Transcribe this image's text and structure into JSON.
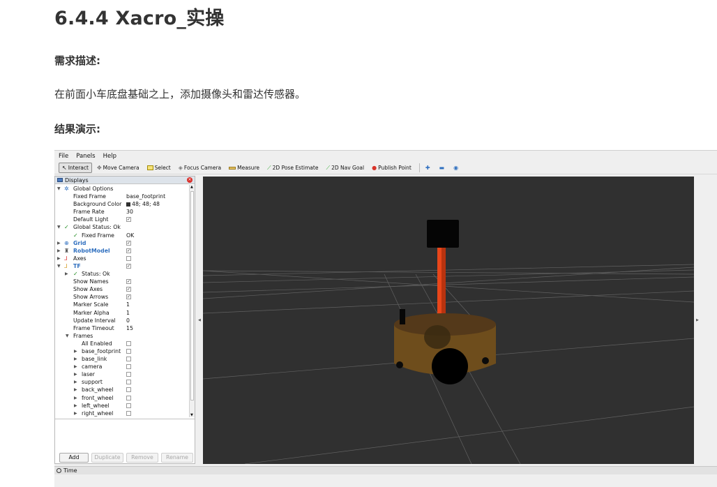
{
  "doc": {
    "title": "6.4.4 Xacro_实操",
    "h_requirement": "需求描述:",
    "p_requirement": "在前面小车底盘基础之上，添加摄像头和雷达传感器。",
    "h_result": "结果演示:"
  },
  "rviz": {
    "menu": {
      "file": "File",
      "panels": "Panels",
      "help": "Help"
    },
    "toolbar": {
      "interact": "Interact",
      "move_camera": "Move Camera",
      "select": "Select",
      "focus_camera": "Focus Camera",
      "measure": "Measure",
      "pose_estimate": "2D Pose Estimate",
      "nav_goal": "2D Nav Goal",
      "publish_point": "Publish Point"
    },
    "displays": {
      "title": "Displays",
      "rows": {
        "global_options": "Global Options",
        "fixed_frame": "Fixed Frame",
        "fixed_frame_val": "base_footprint",
        "bg_color": "Background Color",
        "bg_color_val": "48; 48; 48",
        "frame_rate": "Frame Rate",
        "frame_rate_val": "30",
        "default_light": "Default Light",
        "global_status": "Global Status: Ok",
        "fixed_frame_status": "Fixed Frame",
        "fixed_frame_status_val": "OK",
        "grid": "Grid",
        "robot_model": "RobotModel",
        "axes": "Axes",
        "tf": "TF",
        "tf_status": "Status: Ok",
        "show_names": "Show Names",
        "show_axes": "Show Axes",
        "show_arrows": "Show Arrows",
        "marker_scale": "Marker Scale",
        "marker_scale_val": "1",
        "marker_alpha": "Marker Alpha",
        "marker_alpha_val": "1",
        "update_interval": "Update Interval",
        "update_interval_val": "0",
        "frame_timeout": "Frame Timeout",
        "frame_timeout_val": "15",
        "frames": "Frames",
        "all_enabled": "All Enabled",
        "f_base_footprint": "base_footprint",
        "f_base_link": "base_link",
        "f_camera": "camera",
        "f_laser": "laser",
        "f_support": "support",
        "f_back_wheel": "back_wheel",
        "f_front_wheel": "front_wheel",
        "f_left_wheel": "left_wheel",
        "f_right_wheel": "right_wheel"
      },
      "buttons": {
        "add": "Add",
        "duplicate": "Duplicate",
        "remove": "Remove",
        "rename": "Rename"
      }
    },
    "time_panel": "Time",
    "colors": {
      "view_bg": "#303030",
      "support": "#e8461a",
      "base": "#6e4d1c",
      "wheel": "#000000"
    }
  }
}
